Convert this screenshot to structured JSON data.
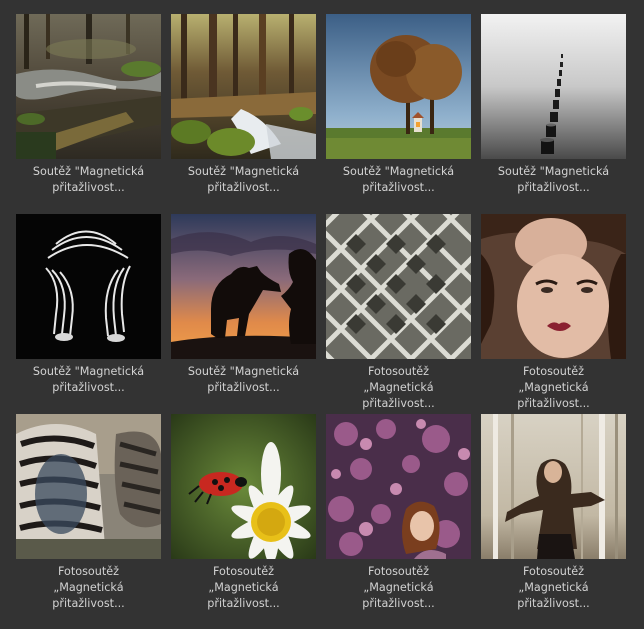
{
  "gallery": {
    "items": [
      {
        "thumbnail_icon": "forest-stream-photo",
        "caption_lines": [
          "Soutěž \"Magnetická",
          "přitažlivost..."
        ]
      },
      {
        "thumbnail_icon": "forest-waterfall-photo",
        "caption_lines": [
          "Soutěž \"Magnetická",
          "přitažlivost..."
        ]
      },
      {
        "thumbnail_icon": "lone-tree-chapel-photo",
        "caption_lines": [
          "Soutěž \"Magnetická",
          "přitažlivost..."
        ]
      },
      {
        "thumbnail_icon": "wooden-posts-sea-photo",
        "caption_lines": [
          "Soutěž \"Magnetická",
          "přitažlivost..."
        ]
      },
      {
        "thumbnail_icon": "striped-body-art-photo",
        "caption_lines": [
          "Soutěž \"Magnetická",
          "přitažlivost..."
        ]
      },
      {
        "thumbnail_icon": "dog-silhouette-sunset-photo",
        "caption_lines": [
          "Soutěž \"Magnetická",
          "přitažlivost..."
        ]
      },
      {
        "thumbnail_icon": "frosted-fence-photo",
        "caption_lines": [
          "Fotosoutěž",
          "„Magnetická",
          "přitažlivost..."
        ]
      },
      {
        "thumbnail_icon": "two-women-portrait-photo",
        "caption_lines": [
          "Fotosoutěž",
          "„Magnetická",
          "přitažlivost..."
        ]
      },
      {
        "thumbnail_icon": "zebra-hug-photo",
        "caption_lines": [
          "Fotosoutěž",
          "„Magnetická",
          "přitažlivost..."
        ]
      },
      {
        "thumbnail_icon": "ladybug-daisy-photo",
        "caption_lines": [
          "Fotosoutěž",
          "„Magnetická",
          "přitažlivost..."
        ]
      },
      {
        "thumbnail_icon": "woman-magnolia-photo",
        "caption_lines": [
          "Fotosoutěž",
          "„Magnetická",
          "přitažlivost..."
        ]
      },
      {
        "thumbnail_icon": "woman-fur-coat-birch-photo",
        "caption_lines": [
          "Fotosoutěž",
          "„Magnetická",
          "přitažlivost..."
        ]
      }
    ]
  },
  "colors": {
    "background": "#333333",
    "caption_text": "#d2d2d2"
  }
}
